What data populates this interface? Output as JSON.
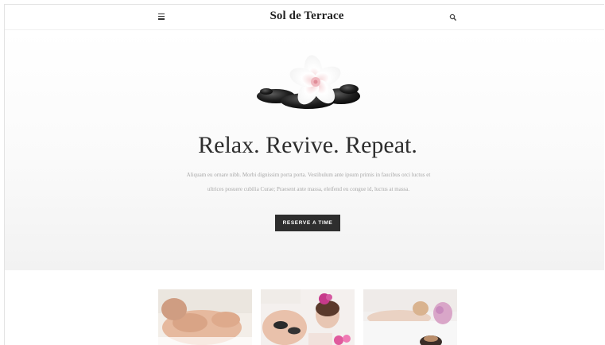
{
  "header": {
    "title": "Sol de Terrace",
    "menu_icon": "hamburger-menu-icon",
    "search_icon": "magnifier-search-icon"
  },
  "hero": {
    "image": "white-frangipani-flower-on-black-spa-stones",
    "headline": "Relax. Revive. Repeat.",
    "text": "Aliquam eu ornare nibh. Morbi dignissim porta porta. Vestibulum ante ipsum primis in faucibus orci luctus et ultrices posuere cubilia Curae; Praesent ante massa, eleifend eu congue id, luctus at massa.",
    "cta_label": "RESERVE A TIME"
  },
  "gallery": {
    "items": [
      "back-massage-photo",
      "hot-stone-massage-photo",
      "spa-relaxation-photo"
    ]
  },
  "colors": {
    "text_dark": "#2d2d2d",
    "text_muted": "#a8a8a8",
    "button_bg": "#2e2e2e",
    "button_text": "#ffffff",
    "hero_bg": "#f5f5f5"
  }
}
